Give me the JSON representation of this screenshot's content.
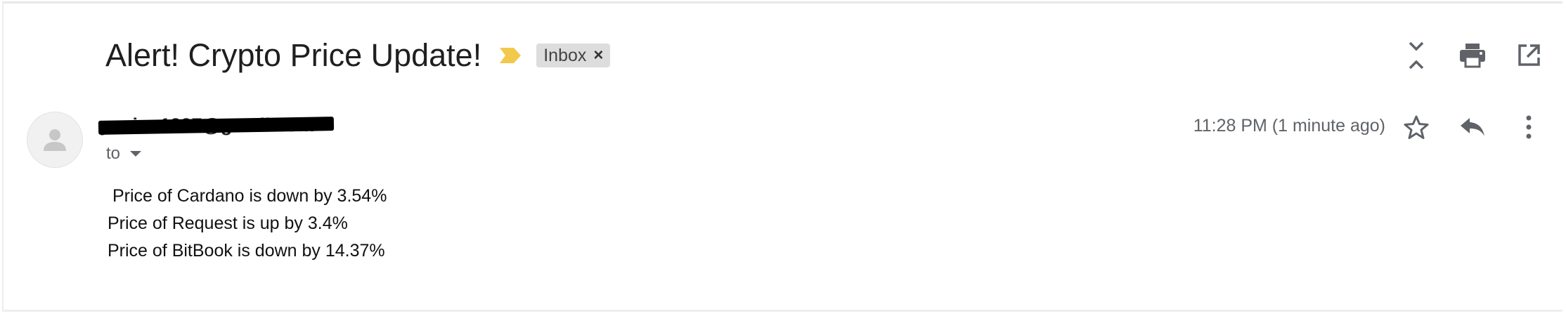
{
  "email": {
    "subject": "Alert! Crypto Price Update!",
    "label": "Inbox",
    "label_remove": "×",
    "sender": "yuvins1997@gmail.com",
    "recipient_prefix": "to",
    "timestamp": "11:28 PM (1 minute ago)",
    "body_lines": [
      " Price of Cardano is down by 3.54%",
      "Price of Request is up by 3.4%",
      "Price of BitBook is down by 14.37%"
    ]
  },
  "icons": {
    "importance": "importance-marker-icon",
    "collapse": "collapse-all-icon",
    "print": "print-icon",
    "open_new": "open-in-new-window-icon",
    "avatar": "person-icon",
    "star": "star-icon",
    "reply": "reply-icon",
    "more": "more-vert-icon"
  },
  "colors": {
    "importance": "#f2c94c",
    "chip_bg": "#dddddd",
    "icon": "#5f6368"
  }
}
